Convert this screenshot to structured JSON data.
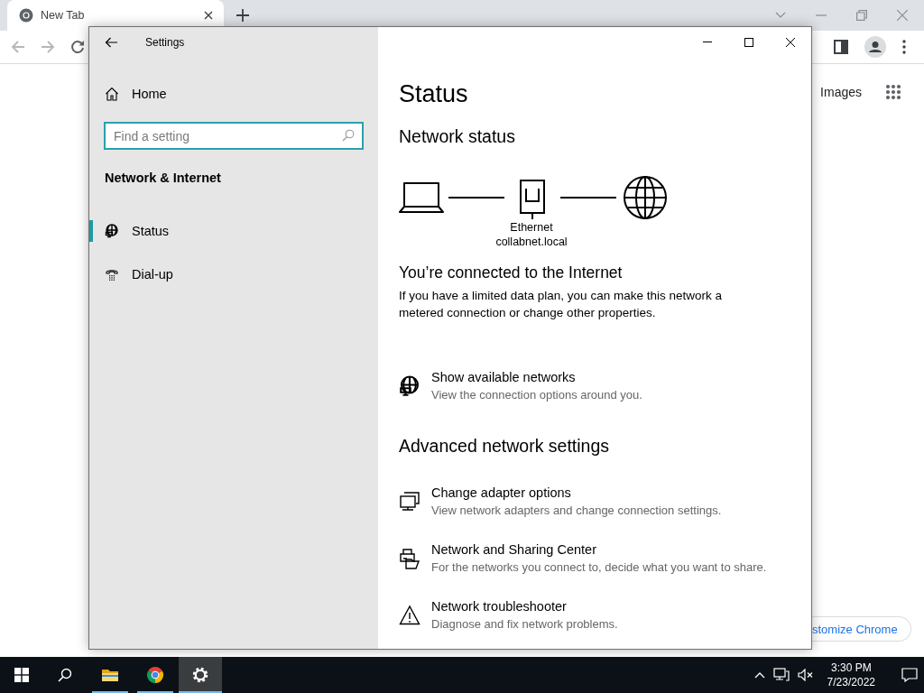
{
  "browser": {
    "tab": {
      "title": "New Tab",
      "selected": true
    },
    "links": [
      {
        "label": "Images"
      }
    ],
    "customize_button": {
      "label": "stomize Chrome"
    }
  },
  "settings": {
    "title": "Settings",
    "home": "Home",
    "search": {
      "placeholder": "Find a setting"
    },
    "section": "Network & Internet",
    "nav_items": [
      {
        "label": "Status",
        "kind": "globe-monitor",
        "selected": true
      },
      {
        "label": "Dial-up",
        "kind": "phone",
        "selected": false
      }
    ],
    "page_title": "Status",
    "network_status": {
      "heading": "Network status",
      "adapter": "Ethernet",
      "network": "collabnet.local"
    },
    "connection": {
      "heading": "You’re connected to the Internet",
      "text": "If you have a limited data plan, you can make this network a metered connection or change other properties."
    },
    "links": [
      {
        "kind": "globe-monitor",
        "title": "Show available networks",
        "description": "View the connection options around you."
      }
    ],
    "advanced": {
      "heading": "Advanced network settings",
      "items": [
        {
          "kind": "monitors",
          "title": "Change adapter options",
          "description": "View network adapters and change connection settings."
        },
        {
          "kind": "sharing",
          "title": "Network and Sharing Center",
          "description": "For the networks you connect to, decide what you want to share."
        },
        {
          "kind": "warning",
          "title": "Network troubleshooter",
          "description": "Diagnose and fix network problems."
        }
      ]
    }
  },
  "taskbar": {
    "apps": [
      {
        "kind": "folder",
        "running": true,
        "selected": false
      },
      {
        "kind": "browser",
        "running": true,
        "selected": false
      },
      {
        "kind": "gear",
        "running": true,
        "selected": true
      }
    ],
    "time": "3:30 PM",
    "date": "7/23/2022"
  }
}
